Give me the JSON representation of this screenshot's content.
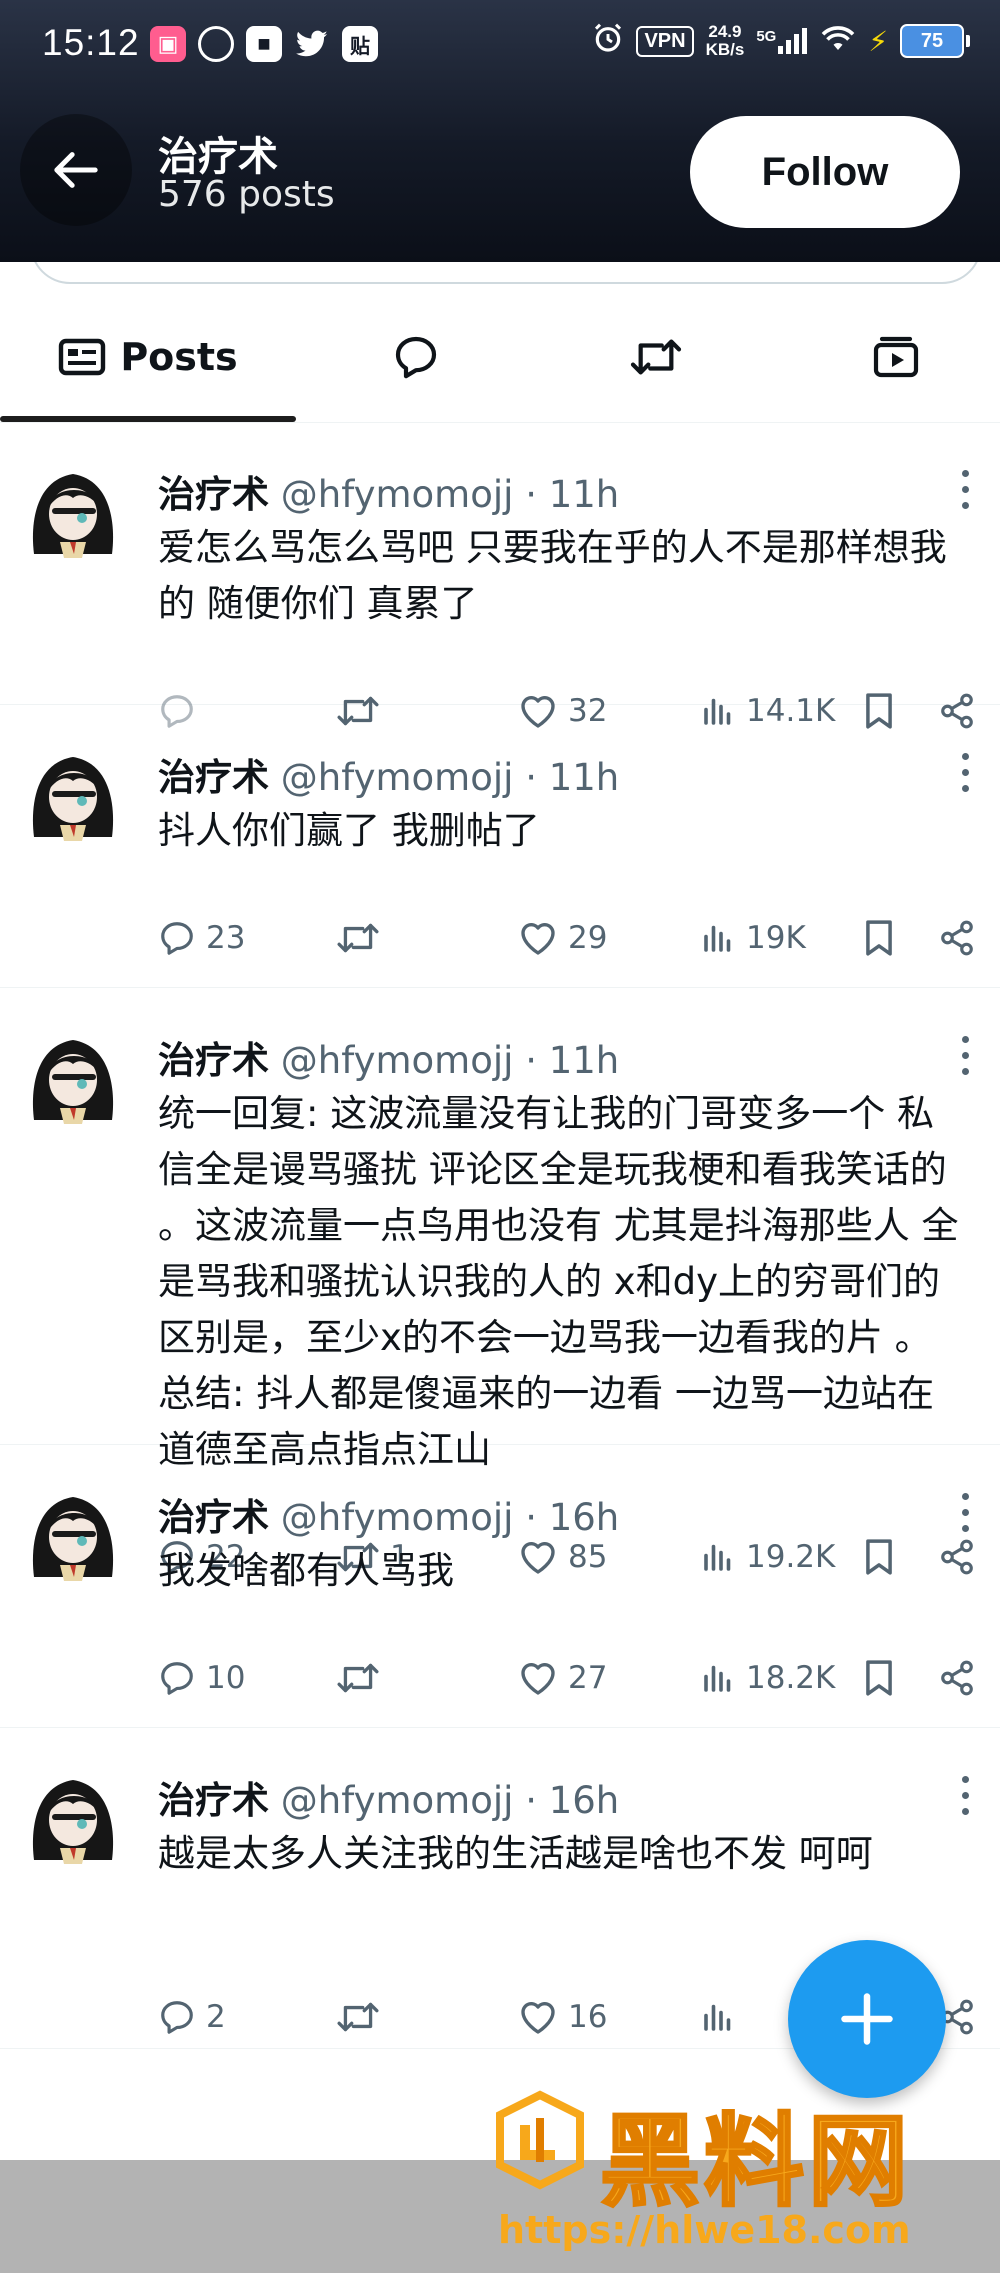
{
  "status_bar": {
    "time": "15:12",
    "vpn": "VPN",
    "speed_value": "24.9",
    "speed_unit": "KB/s",
    "network": "5G",
    "battery": "75"
  },
  "header": {
    "back_icon": "arrow-left-icon",
    "name": "治疗术",
    "post_count": "576 posts",
    "follow_label": "Follow"
  },
  "tabs": [
    {
      "label": "Posts",
      "icon": "posts-icon",
      "active": true
    },
    {
      "label": "",
      "icon": "replies-icon"
    },
    {
      "label": "",
      "icon": "reposts-icon"
    },
    {
      "label": "",
      "icon": "media-icon"
    }
  ],
  "posts": [
    {
      "name": "治疗术",
      "handle": "@hfymomojj",
      "time": "11h",
      "text": "爱怎么骂怎么骂吧 只要我在乎的人不是那样想我的 随便你们 真累了",
      "replies": "",
      "reposts": "",
      "likes": "32",
      "views": "14.1K"
    },
    {
      "name": "治疗术",
      "handle": "@hfymomojj",
      "time": "11h",
      "text": "抖人你们赢了 我删帖了",
      "replies": "23",
      "reposts": "",
      "likes": "29",
      "views": "19K"
    },
    {
      "name": "治疗术",
      "handle": "@hfymomojj",
      "time": "11h",
      "text": "统一回复: 这波流量没有让我的门哥变多一个 私信全是谩骂骚扰 评论区全是玩我梗和看我笑话的 。这波流量一点鸟用也没有 尤其是抖海那些人 全是骂我和骚扰认识我的人的 x和dy上的穷哥们的区别是，至少x的不会一边骂我一边看我的片 。总结: 抖人都是傻逼来的一边看 一边骂一边站在道德至高点指点江山",
      "replies": "22",
      "reposts": "1",
      "likes": "85",
      "views": "19.2K"
    },
    {
      "name": "治疗术",
      "handle": "@hfymomojj",
      "time": "16h",
      "text": "我发啥都有人骂我",
      "replies": "10",
      "reposts": "",
      "likes": "27",
      "views": "18.2K"
    },
    {
      "name": "治疗术",
      "handle": "@hfymomojj",
      "time": "16h",
      "text": "越是太多人关注我的生活越是啥也不发 呵呵",
      "replies": "2",
      "reposts": "",
      "likes": "16",
      "views": ""
    }
  ],
  "watermark": {
    "title": "黑料网",
    "url": "https://hlwe18.com"
  },
  "colors": {
    "accent": "#1d9bf0",
    "muted": "#536471",
    "watermark": "#f7a81b"
  }
}
